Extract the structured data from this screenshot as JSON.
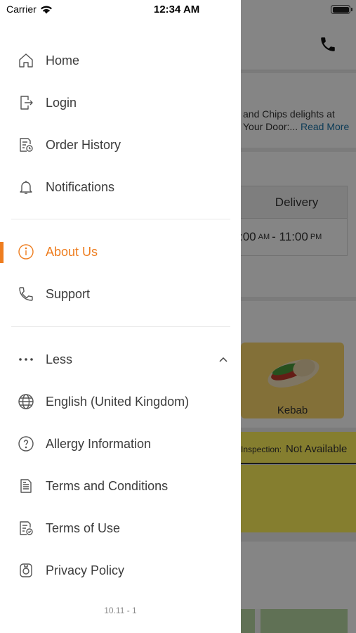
{
  "status_bar": {
    "carrier": "Carrier",
    "time": "12:34 AM"
  },
  "drawer": {
    "items": [
      {
        "label": "Home",
        "icon": "home-icon"
      },
      {
        "label": "Login",
        "icon": "login-icon"
      },
      {
        "label": "Order History",
        "icon": "order-history-icon"
      },
      {
        "label": "Notifications",
        "icon": "bell-icon"
      },
      {
        "label": "About Us",
        "icon": "info-icon",
        "active": true
      },
      {
        "label": "Support",
        "icon": "phone-icon"
      },
      {
        "label": "Less",
        "icon": "more-dots-icon"
      },
      {
        "label": "English (United Kingdom)",
        "icon": "globe-icon"
      },
      {
        "label": "Allergy Information",
        "icon": "question-icon"
      },
      {
        "label": "Terms and Conditions",
        "icon": "document-icon"
      },
      {
        "label": "Terms of Use",
        "icon": "document-check-icon"
      },
      {
        "label": "Privacy Policy",
        "icon": "privacy-icon"
      }
    ],
    "version": "10.11 - 1",
    "active_color": "#ee7d1f"
  },
  "background": {
    "description_line1": "and Chips delights at",
    "description_line2": "Your Door:...",
    "read_more": "Read More",
    "hours_header": "Delivery",
    "hours_open": ":00",
    "hours_open_suffix": "AM",
    "hours_sep": "-",
    "hours_close": "11:00",
    "hours_close_suffix": "PM",
    "menu_category": "Kebab",
    "inspection_label": "Inspection:",
    "inspection_value": "Not Available"
  }
}
